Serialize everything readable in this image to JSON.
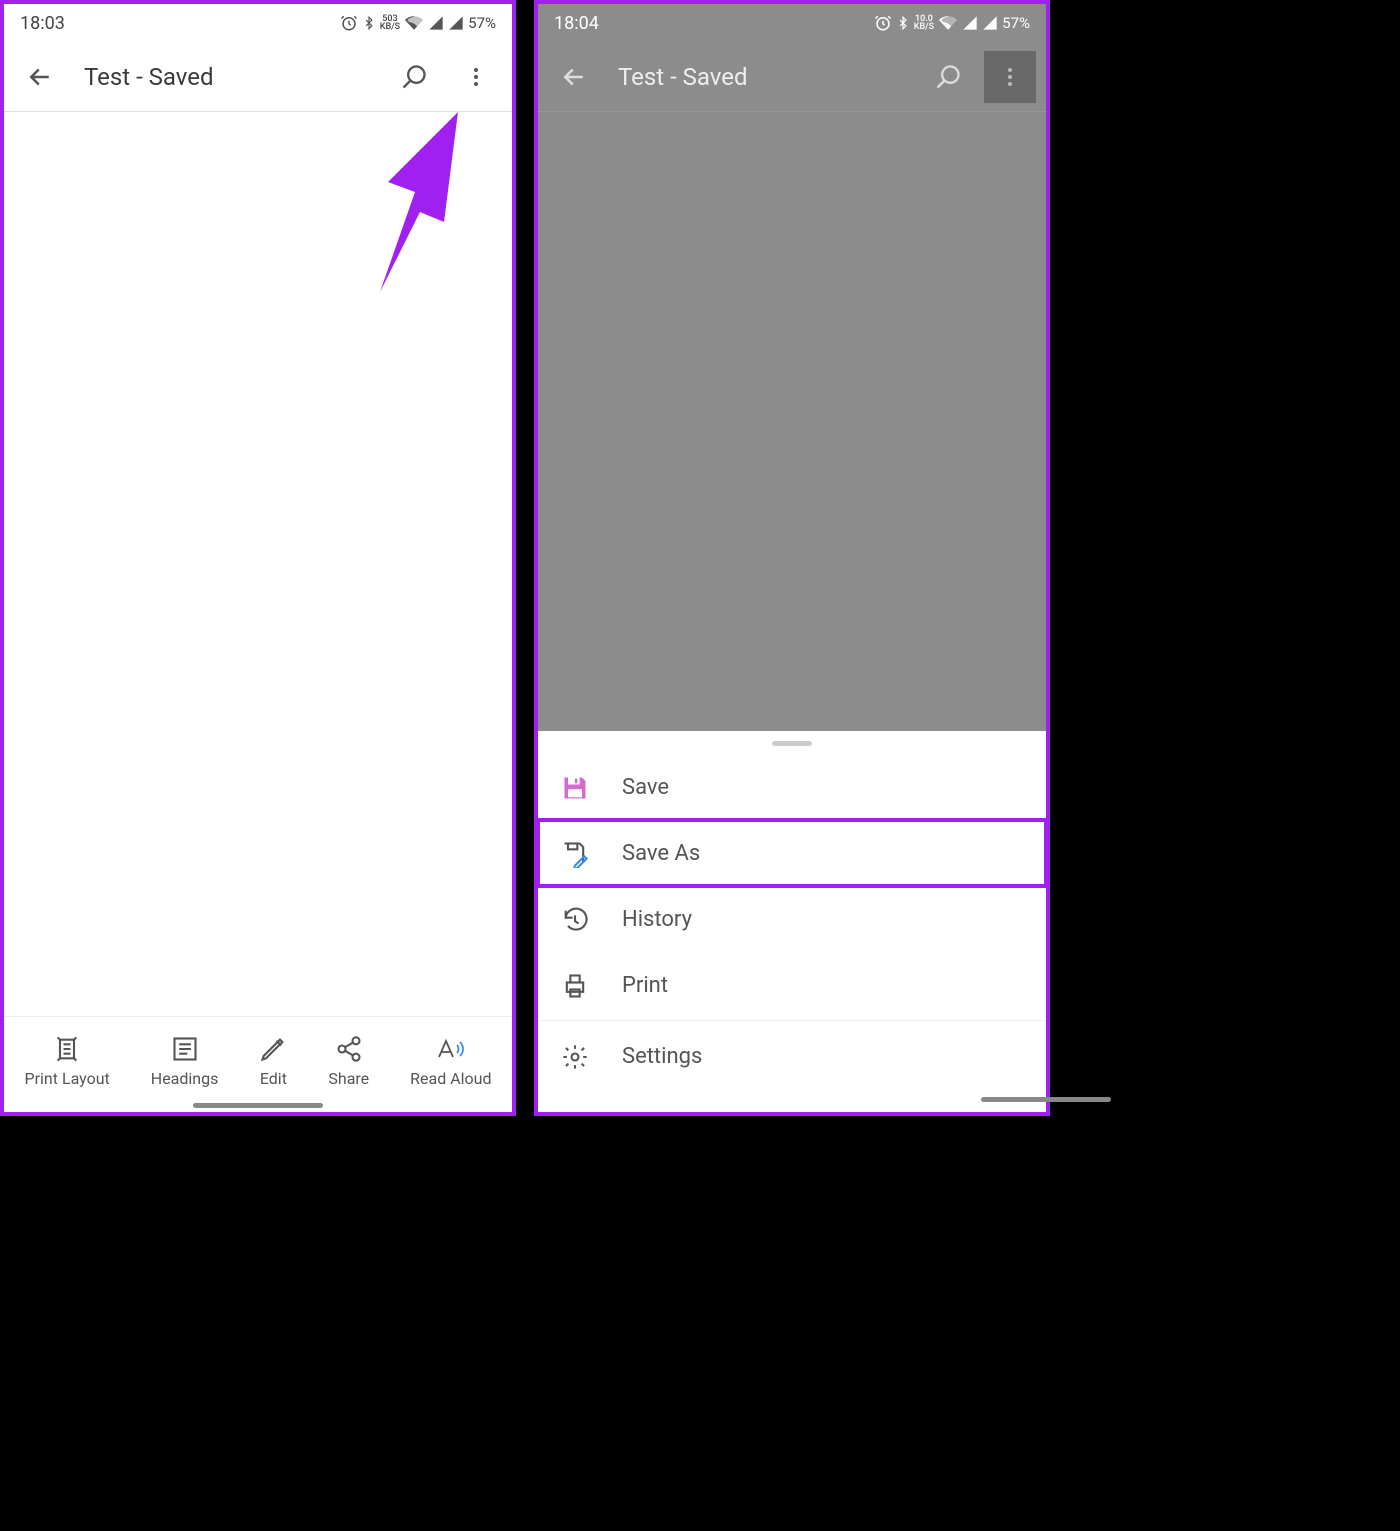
{
  "phone_a": {
    "status": {
      "time": "18:03",
      "net_speed_top": "503",
      "net_speed_bot": "KB/S",
      "battery": "57%"
    },
    "toolbar": {
      "title": "Test - Saved"
    },
    "bottom": {
      "print_layout": "Print Layout",
      "headings": "Headings",
      "edit": "Edit",
      "share": "Share",
      "read_aloud": "Read Aloud"
    }
  },
  "phone_b": {
    "status": {
      "time": "18:04",
      "net_speed_top": "10.0",
      "net_speed_bot": "KB/S",
      "battery": "57%"
    },
    "toolbar": {
      "title": "Test - Saved"
    },
    "menu": {
      "save": "Save",
      "save_as": "Save As",
      "history": "History",
      "print": "Print",
      "settings": "Settings"
    }
  },
  "colors": {
    "accent_purple": "#a020f0",
    "save_pink": "#d36bd3"
  }
}
